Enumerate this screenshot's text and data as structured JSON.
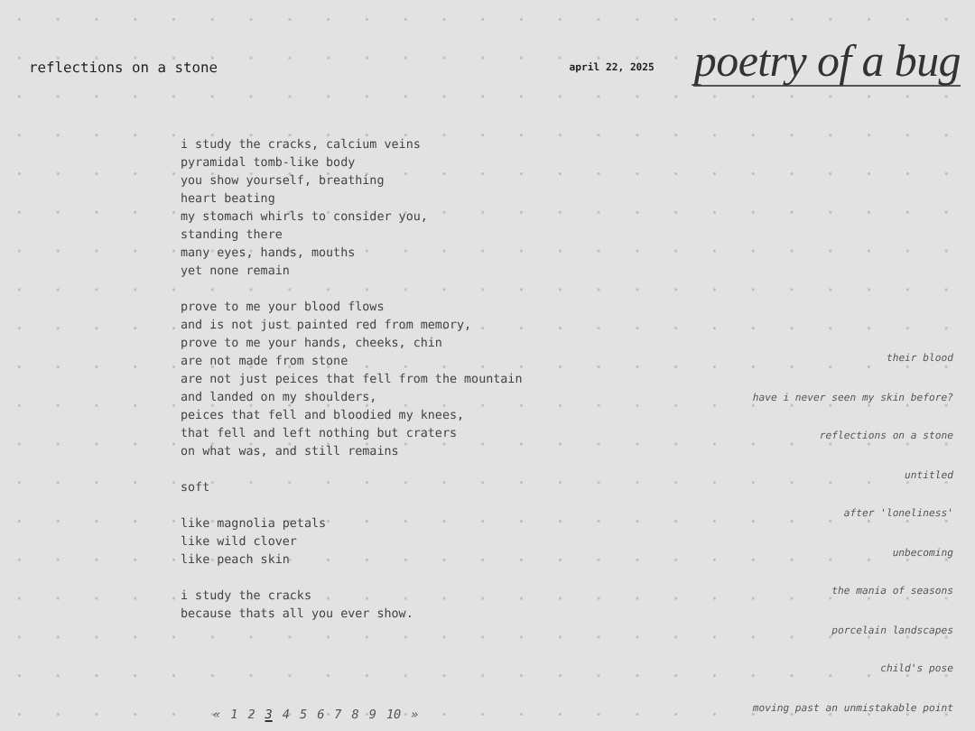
{
  "header": {
    "poem_title": "reflections on a stone",
    "date": "april 22, 2025",
    "site_title": "poetry of a bug"
  },
  "poem": {
    "stanzas": [
      [
        "i study the cracks, calcium veins",
        "pyramidal tomb-like body",
        "you show yourself, breathing",
        "heart beating",
        "my stomach whirls to consider you,",
        "standing there",
        "many eyes, hands, mouths",
        "yet none remain"
      ],
      [
        "prove to me your blood flows",
        "and is not just painted red from memory,",
        "prove to me your hands, cheeks, chin",
        "are not made from stone",
        "are not just peices that fell from the mountain",
        "and landed on my shoulders,",
        "peices that fell and bloodied my knees,",
        "that fell and left nothing but craters",
        "on what was, and still remains"
      ],
      [
        "soft"
      ],
      [
        "like magnolia petals",
        "like wild clover",
        "like peach skin"
      ],
      [
        "i study the cracks",
        "because thats all you ever show."
      ]
    ]
  },
  "sidebar": {
    "items": [
      "their blood",
      "have i never seen my skin before?",
      "reflections on a stone",
      "untitled",
      "after 'loneliness'",
      "unbecoming",
      "the mania of seasons",
      "porcelain landscapes",
      "child's pose",
      "moving past an unmistakable point"
    ]
  },
  "pagination": {
    "previous": "«",
    "next": "»",
    "pages": [
      {
        "label": "1",
        "selected": false
      },
      {
        "label": "2",
        "selected": false
      },
      {
        "label": "3",
        "selected": true
      },
      {
        "label": "4",
        "selected": false
      },
      {
        "label": "5",
        "selected": false
      },
      {
        "label": "6",
        "selected": false
      },
      {
        "label": "7",
        "selected": false
      },
      {
        "label": "8",
        "selected": false
      },
      {
        "label": "9",
        "selected": false
      },
      {
        "label": "10",
        "selected": false
      }
    ]
  }
}
